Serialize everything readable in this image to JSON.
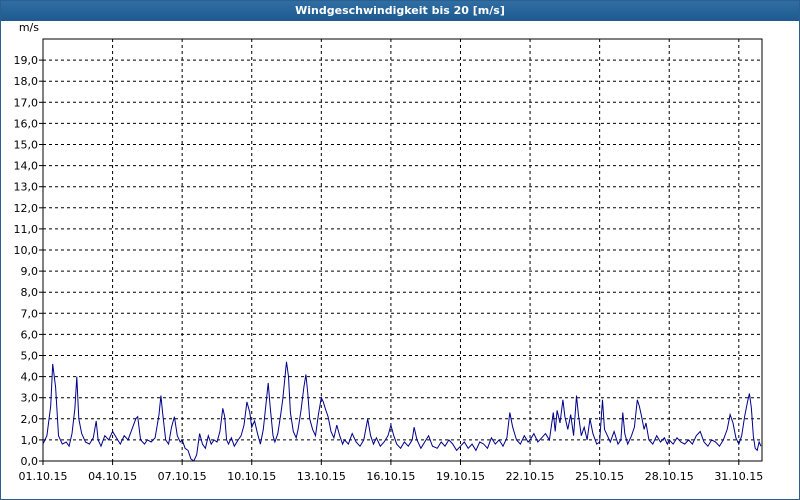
{
  "window": {
    "title": "Windgeschwindigkeit bis 20 [m/s]"
  },
  "chart_data": {
    "type": "line",
    "title": "Windgeschwindigkeit bis 20 [m/s]",
    "ylabel": "m/s",
    "xlabel": "",
    "ylim": [
      0,
      20
    ],
    "xlim": [
      "2015-10-01",
      "2015-11-01"
    ],
    "y_ticks": [
      "0,0",
      "1,0",
      "2,0",
      "3,0",
      "4,0",
      "5,0",
      "6,0",
      "7,0",
      "8,0",
      "9,0",
      "10,0",
      "11,0",
      "12,0",
      "13,0",
      "14,0",
      "15,0",
      "16,0",
      "17,0",
      "18,0",
      "19,0"
    ],
    "x_ticks": [
      {
        "date": "2015-10-01",
        "label": "01.10.15"
      },
      {
        "date": "2015-10-04",
        "label": "04.10.15"
      },
      {
        "date": "2015-10-07",
        "label": "07.10.15"
      },
      {
        "date": "2015-10-10",
        "label": "10.10.15"
      },
      {
        "date": "2015-10-13",
        "label": "13.10.15"
      },
      {
        "date": "2015-10-16",
        "label": "16.10.15"
      },
      {
        "date": "2015-10-19",
        "label": "19.10.15"
      },
      {
        "date": "2015-10-22",
        "label": "22.10.15"
      },
      {
        "date": "2015-10-25",
        "label": "25.10.15"
      },
      {
        "date": "2015-10-28",
        "label": "28.10.15"
      },
      {
        "date": "2015-10-31",
        "label": "31.10.15"
      }
    ],
    "grid": true,
    "series": [
      {
        "color": "#00008b",
        "points": [
          [
            "2015-10-01 00:00",
            0.8
          ],
          [
            "2015-10-01 04:00",
            1.2
          ],
          [
            "2015-10-01 08:00",
            2.6
          ],
          [
            "2015-10-01 10:00",
            4.6
          ],
          [
            "2015-10-01 13:00",
            3.5
          ],
          [
            "2015-10-01 16:00",
            1.2
          ],
          [
            "2015-10-01 20:00",
            0.8
          ],
          [
            "2015-10-02 00:00",
            0.9
          ],
          [
            "2015-10-02 03:00",
            0.7
          ],
          [
            "2015-10-02 06:00",
            1.3
          ],
          [
            "2015-10-02 09:00",
            2.5
          ],
          [
            "2015-10-02 11:00",
            4.0
          ],
          [
            "2015-10-02 13:00",
            2.0
          ],
          [
            "2015-10-02 16:00",
            1.3
          ],
          [
            "2015-10-02 20:00",
            0.9
          ],
          [
            "2015-10-03 00:00",
            0.8
          ],
          [
            "2015-10-03 04:00",
            1.1
          ],
          [
            "2015-10-03 07:00",
            1.9
          ],
          [
            "2015-10-03 09:00",
            1.0
          ],
          [
            "2015-10-03 12:00",
            0.7
          ],
          [
            "2015-10-03 16:00",
            1.2
          ],
          [
            "2015-10-03 20:00",
            1.0
          ],
          [
            "2015-10-04 00:00",
            1.4
          ],
          [
            "2015-10-04 04:00",
            1.1
          ],
          [
            "2015-10-04 08:00",
            0.8
          ],
          [
            "2015-10-04 12:00",
            1.2
          ],
          [
            "2015-10-04 16:00",
            1.0
          ],
          [
            "2015-10-04 20:00",
            1.5
          ],
          [
            "2015-10-05 00:00",
            2.0
          ],
          [
            "2015-10-05 02:00",
            2.1
          ],
          [
            "2015-10-05 05:00",
            1.0
          ],
          [
            "2015-10-05 09:00",
            0.8
          ],
          [
            "2015-10-05 12:00",
            1.0
          ],
          [
            "2015-10-05 16:00",
            0.9
          ],
          [
            "2015-10-05 20:00",
            1.1
          ],
          [
            "2015-10-06 00:00",
            2.2
          ],
          [
            "2015-10-06 02:00",
            3.1
          ],
          [
            "2015-10-06 04:00",
            2.2
          ],
          [
            "2015-10-06 07:00",
            1.0
          ],
          [
            "2015-10-06 10:00",
            0.8
          ],
          [
            "2015-10-06 13:00",
            1.6
          ],
          [
            "2015-10-06 16:00",
            2.1
          ],
          [
            "2015-10-06 19:00",
            1.2
          ],
          [
            "2015-10-06 22:00",
            0.9
          ],
          [
            "2015-10-07 00:00",
            1.0
          ],
          [
            "2015-10-07 03:00",
            0.6
          ],
          [
            "2015-10-07 06:00",
            0.5
          ],
          [
            "2015-10-07 09:00",
            0.1
          ],
          [
            "2015-10-07 12:00",
            0.0
          ],
          [
            "2015-10-07 15:00",
            0.3
          ],
          [
            "2015-10-07 18:00",
            1.3
          ],
          [
            "2015-10-07 21:00",
            0.8
          ],
          [
            "2015-10-08 00:00",
            0.6
          ],
          [
            "2015-10-08 03:00",
            1.2
          ],
          [
            "2015-10-08 06:00",
            0.8
          ],
          [
            "2015-10-08 09:00",
            1.0
          ],
          [
            "2015-10-08 12:00",
            0.9
          ],
          [
            "2015-10-08 15:00",
            1.4
          ],
          [
            "2015-10-08 18:00",
            2.5
          ],
          [
            "2015-10-08 20:00",
            2.1
          ],
          [
            "2015-10-08 22:00",
            1.0
          ],
          [
            "2015-10-09 00:00",
            0.8
          ],
          [
            "2015-10-09 03:00",
            1.1
          ],
          [
            "2015-10-09 06:00",
            0.7
          ],
          [
            "2015-10-09 10:00",
            1.0
          ],
          [
            "2015-10-09 13:00",
            1.2
          ],
          [
            "2015-10-09 16:00",
            1.7
          ],
          [
            "2015-10-09 19:00",
            2.8
          ],
          [
            "2015-10-09 22:00",
            2.3
          ],
          [
            "2015-10-10 00:00",
            1.6
          ],
          [
            "2015-10-10 03:00",
            1.9
          ],
          [
            "2015-10-10 06:00",
            1.3
          ],
          [
            "2015-10-10 09:00",
            0.8
          ],
          [
            "2015-10-10 12:00",
            1.5
          ],
          [
            "2015-10-10 15:00",
            2.8
          ],
          [
            "2015-10-10 17:00",
            3.7
          ],
          [
            "2015-10-10 19:00",
            2.6
          ],
          [
            "2015-10-10 22:00",
            1.2
          ],
          [
            "2015-10-11 00:00",
            0.9
          ],
          [
            "2015-10-11 03:00",
            1.3
          ],
          [
            "2015-10-11 06:00",
            2.2
          ],
          [
            "2015-10-11 08:00",
            2.9
          ],
          [
            "2015-10-11 10:00",
            3.8
          ],
          [
            "2015-10-11 12:00",
            4.7
          ],
          [
            "2015-10-11 14:00",
            4.0
          ],
          [
            "2015-10-11 16:00",
            2.3
          ],
          [
            "2015-10-11 19:00",
            1.4
          ],
          [
            "2015-10-11 22:00",
            1.1
          ],
          [
            "2015-10-12 00:00",
            1.5
          ],
          [
            "2015-10-12 03:00",
            2.4
          ],
          [
            "2015-10-12 06:00",
            3.5
          ],
          [
            "2015-10-12 08:00",
            4.1
          ],
          [
            "2015-10-12 10:00",
            3.2
          ],
          [
            "2015-10-12 12:00",
            2.0
          ],
          [
            "2015-10-12 15:00",
            1.5
          ],
          [
            "2015-10-12 18:00",
            1.2
          ],
          [
            "2015-10-12 21:00",
            2.2
          ],
          [
            "2015-10-13 00:00",
            3.0
          ],
          [
            "2015-10-13 02:00",
            2.8
          ],
          [
            "2015-10-13 04:00",
            2.5
          ],
          [
            "2015-10-13 07:00",
            2.1
          ],
          [
            "2015-10-13 10:00",
            1.4
          ],
          [
            "2015-10-13 13:00",
            1.1
          ],
          [
            "2015-10-13 16:00",
            1.7
          ],
          [
            "2015-10-13 19:00",
            1.2
          ],
          [
            "2015-10-13 22:00",
            0.8
          ],
          [
            "2015-10-14 00:00",
            1.0
          ],
          [
            "2015-10-14 04:00",
            0.8
          ],
          [
            "2015-10-14 08:00",
            1.3
          ],
          [
            "2015-10-14 12:00",
            0.9
          ],
          [
            "2015-10-14 16:00",
            0.7
          ],
          [
            "2015-10-14 20:00",
            1.0
          ],
          [
            "2015-10-15 00:00",
            2.0
          ],
          [
            "2015-10-15 03:00",
            1.2
          ],
          [
            "2015-10-15 06:00",
            0.8
          ],
          [
            "2015-10-15 09:00",
            1.1
          ],
          [
            "2015-10-15 13:00",
            0.7
          ],
          [
            "2015-10-15 17:00",
            0.9
          ],
          [
            "2015-10-15 21:00",
            1.2
          ],
          [
            "2015-10-16 00:00",
            1.7
          ],
          [
            "2015-10-16 03:00",
            1.2
          ],
          [
            "2015-10-16 06:00",
            0.8
          ],
          [
            "2015-10-16 10:00",
            0.6
          ],
          [
            "2015-10-16 14:00",
            0.9
          ],
          [
            "2015-10-16 18:00",
            0.7
          ],
          [
            "2015-10-16 22:00",
            1.0
          ],
          [
            "2015-10-17 00:00",
            1.6
          ],
          [
            "2015-10-17 03:00",
            1.0
          ],
          [
            "2015-10-17 07:00",
            0.6
          ],
          [
            "2015-10-17 11:00",
            0.9
          ],
          [
            "2015-10-17 15:00",
            1.2
          ],
          [
            "2015-10-17 19:00",
            0.7
          ],
          [
            "2015-10-18 00:00",
            0.6
          ],
          [
            "2015-10-18 04:00",
            0.9
          ],
          [
            "2015-10-18 08:00",
            0.7
          ],
          [
            "2015-10-18 12:00",
            1.0
          ],
          [
            "2015-10-18 16:00",
            0.8
          ],
          [
            "2015-10-18 20:00",
            0.5
          ],
          [
            "2015-10-19 00:00",
            0.7
          ],
          [
            "2015-10-19 04:00",
            0.9
          ],
          [
            "2015-10-19 08:00",
            0.6
          ],
          [
            "2015-10-19 12:00",
            0.8
          ],
          [
            "2015-10-19 16:00",
            0.5
          ],
          [
            "2015-10-19 20:00",
            0.9
          ],
          [
            "2015-10-20 00:00",
            0.8
          ],
          [
            "2015-10-20 04:00",
            0.6
          ],
          [
            "2015-10-20 08:00",
            1.1
          ],
          [
            "2015-10-20 12:00",
            0.8
          ],
          [
            "2015-10-20 16:00",
            1.0
          ],
          [
            "2015-10-20 20:00",
            0.7
          ],
          [
            "2015-10-21 00:00",
            1.1
          ],
          [
            "2015-10-21 03:00",
            2.3
          ],
          [
            "2015-10-21 06:00",
            1.6
          ],
          [
            "2015-10-21 10:00",
            1.0
          ],
          [
            "2015-10-21 14:00",
            0.8
          ],
          [
            "2015-10-21 18:00",
            1.2
          ],
          [
            "2015-10-21 22:00",
            0.9
          ],
          [
            "2015-10-22 00:00",
            1.0
          ],
          [
            "2015-10-22 04:00",
            1.3
          ],
          [
            "2015-10-22 08:00",
            0.9
          ],
          [
            "2015-10-22 12:00",
            1.1
          ],
          [
            "2015-10-22 16:00",
            1.3
          ],
          [
            "2015-10-22 20:00",
            1.0
          ],
          [
            "2015-10-23 00:00",
            2.3
          ],
          [
            "2015-10-23 02:00",
            1.4
          ],
          [
            "2015-10-23 04:00",
            2.4
          ],
          [
            "2015-10-23 07:00",
            1.8
          ],
          [
            "2015-10-23 10:00",
            2.9
          ],
          [
            "2015-10-23 12:00",
            2.1
          ],
          [
            "2015-10-23 15:00",
            1.5
          ],
          [
            "2015-10-23 18:00",
            2.2
          ],
          [
            "2015-10-23 21:00",
            1.2
          ],
          [
            "2015-10-24 00:00",
            3.1
          ],
          [
            "2015-10-24 02:00",
            2.2
          ],
          [
            "2015-10-24 05:00",
            1.2
          ],
          [
            "2015-10-24 08:00",
            1.6
          ],
          [
            "2015-10-24 11:00",
            1.0
          ],
          [
            "2015-10-24 14:00",
            2.0
          ],
          [
            "2015-10-24 17:00",
            1.3
          ],
          [
            "2015-10-24 21:00",
            0.8
          ],
          [
            "2015-10-25 00:00",
            0.9
          ],
          [
            "2015-10-25 03:00",
            2.9
          ],
          [
            "2015-10-25 05:00",
            1.5
          ],
          [
            "2015-10-25 08:00",
            1.2
          ],
          [
            "2015-10-25 11:00",
            0.9
          ],
          [
            "2015-10-25 15:00",
            1.4
          ],
          [
            "2015-10-25 19:00",
            0.8
          ],
          [
            "2015-10-25 22:00",
            1.0
          ],
          [
            "2015-10-26 00:00",
            2.3
          ],
          [
            "2015-10-26 02:00",
            1.3
          ],
          [
            "2015-10-26 05:00",
            0.8
          ],
          [
            "2015-10-26 09:00",
            1.2
          ],
          [
            "2015-10-26 12:00",
            1.6
          ],
          [
            "2015-10-26 15:00",
            2.9
          ],
          [
            "2015-10-26 17:00",
            2.6
          ],
          [
            "2015-10-26 19:00",
            2.2
          ],
          [
            "2015-10-26 22:00",
            1.5
          ],
          [
            "2015-10-27 00:00",
            1.8
          ],
          [
            "2015-10-27 03:00",
            1.0
          ],
          [
            "2015-10-27 07:00",
            0.8
          ],
          [
            "2015-10-27 11:00",
            1.2
          ],
          [
            "2015-10-27 15:00",
            0.9
          ],
          [
            "2015-10-27 19:00",
            1.1
          ],
          [
            "2015-10-27 22:00",
            0.8
          ],
          [
            "2015-10-28 00:00",
            1.0
          ],
          [
            "2015-10-28 04:00",
            0.8
          ],
          [
            "2015-10-28 08:00",
            1.1
          ],
          [
            "2015-10-28 12:00",
            0.9
          ],
          [
            "2015-10-28 16:00",
            0.8
          ],
          [
            "2015-10-28 20:00",
            1.0
          ],
          [
            "2015-10-29 00:00",
            0.8
          ],
          [
            "2015-10-29 04:00",
            1.2
          ],
          [
            "2015-10-29 08:00",
            1.4
          ],
          [
            "2015-10-29 12:00",
            0.9
          ],
          [
            "2015-10-29 16:00",
            0.7
          ],
          [
            "2015-10-29 20:00",
            1.0
          ],
          [
            "2015-10-30 00:00",
            0.9
          ],
          [
            "2015-10-30 04:00",
            0.7
          ],
          [
            "2015-10-30 08:00",
            1.0
          ],
          [
            "2015-10-30 12:00",
            1.5
          ],
          [
            "2015-10-30 15:00",
            2.2
          ],
          [
            "2015-10-30 18:00",
            1.8
          ],
          [
            "2015-10-30 21:00",
            1.1
          ],
          [
            "2015-10-31 00:00",
            0.8
          ],
          [
            "2015-10-31 03:00",
            1.2
          ],
          [
            "2015-10-31 06:00",
            2.1
          ],
          [
            "2015-10-31 09:00",
            2.8
          ],
          [
            "2015-10-31 11:00",
            3.2
          ],
          [
            "2015-10-31 13:00",
            2.5
          ],
          [
            "2015-10-31 15:00",
            1.2
          ],
          [
            "2015-10-31 17:00",
            0.6
          ],
          [
            "2015-10-31 19:00",
            0.5
          ],
          [
            "2015-10-31 21:00",
            0.9
          ],
          [
            "2015-10-31 23:00",
            0.7
          ]
        ]
      }
    ]
  }
}
